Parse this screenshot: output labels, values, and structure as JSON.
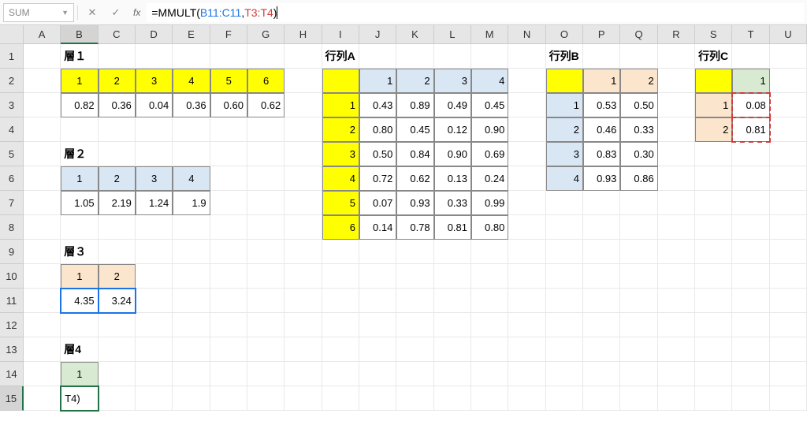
{
  "namebox": "SUM",
  "fx_label": "fx",
  "formula": {
    "pre": "=MMULT(",
    "arg1": "B11:C11",
    "sep": ",",
    "arg2": "T3:T4",
    "post": ")"
  },
  "cols": [
    "A",
    "B",
    "C",
    "D",
    "E",
    "F",
    "G",
    "H",
    "I",
    "J",
    "K",
    "L",
    "M",
    "N",
    "O",
    "P",
    "Q",
    "R",
    "S",
    "T",
    "U"
  ],
  "row_count": 15,
  "labels": {
    "l1": "層１",
    "l2": "層２",
    "l3": "層３",
    "l4": "層4",
    "ma": "行列A",
    "mb": "行列B",
    "mc": "行列C"
  },
  "layer1": {
    "h": [
      "1",
      "2",
      "3",
      "4",
      "5",
      "6"
    ],
    "v": [
      "0.82",
      "0.36",
      "0.04",
      "0.36",
      "0.60",
      "0.62"
    ]
  },
  "layer2": {
    "h": [
      "1",
      "2",
      "3",
      "4"
    ],
    "v": [
      "1.05",
      "2.19",
      "1.24",
      "1.9"
    ]
  },
  "layer3": {
    "h": [
      "1",
      "2"
    ],
    "v": [
      "4.35",
      "3.24"
    ]
  },
  "layer4": {
    "h": "1",
    "v": "T4)"
  },
  "matA": {
    "ch": [
      "1",
      "2",
      "3",
      "4"
    ],
    "rh": [
      "1",
      "2",
      "3",
      "4",
      "5",
      "6"
    ],
    "rows": [
      [
        "0.43",
        "0.89",
        "0.49",
        "0.45"
      ],
      [
        "0.80",
        "0.45",
        "0.12",
        "0.90"
      ],
      [
        "0.50",
        "0.84",
        "0.90",
        "0.69"
      ],
      [
        "0.72",
        "0.62",
        "0.13",
        "0.24"
      ],
      [
        "0.07",
        "0.93",
        "0.33",
        "0.99"
      ],
      [
        "0.14",
        "0.78",
        "0.81",
        "0.80"
      ]
    ]
  },
  "matB": {
    "ch": [
      "1",
      "2"
    ],
    "rh": [
      "1",
      "2",
      "3",
      "4"
    ],
    "rows": [
      [
        "0.53",
        "0.50"
      ],
      [
        "0.46",
        "0.33"
      ],
      [
        "0.83",
        "0.30"
      ],
      [
        "0.93",
        "0.86"
      ]
    ]
  },
  "matC": {
    "ch": [
      "1"
    ],
    "rh": [
      "1",
      "2"
    ],
    "rows": [
      [
        "0.08"
      ],
      [
        "0.81"
      ]
    ]
  },
  "chart_data": {
    "type": "table",
    "source": "spreadsheet",
    "note": "Excel worksheet showing matrix multiplication (MMULT) across layers"
  }
}
